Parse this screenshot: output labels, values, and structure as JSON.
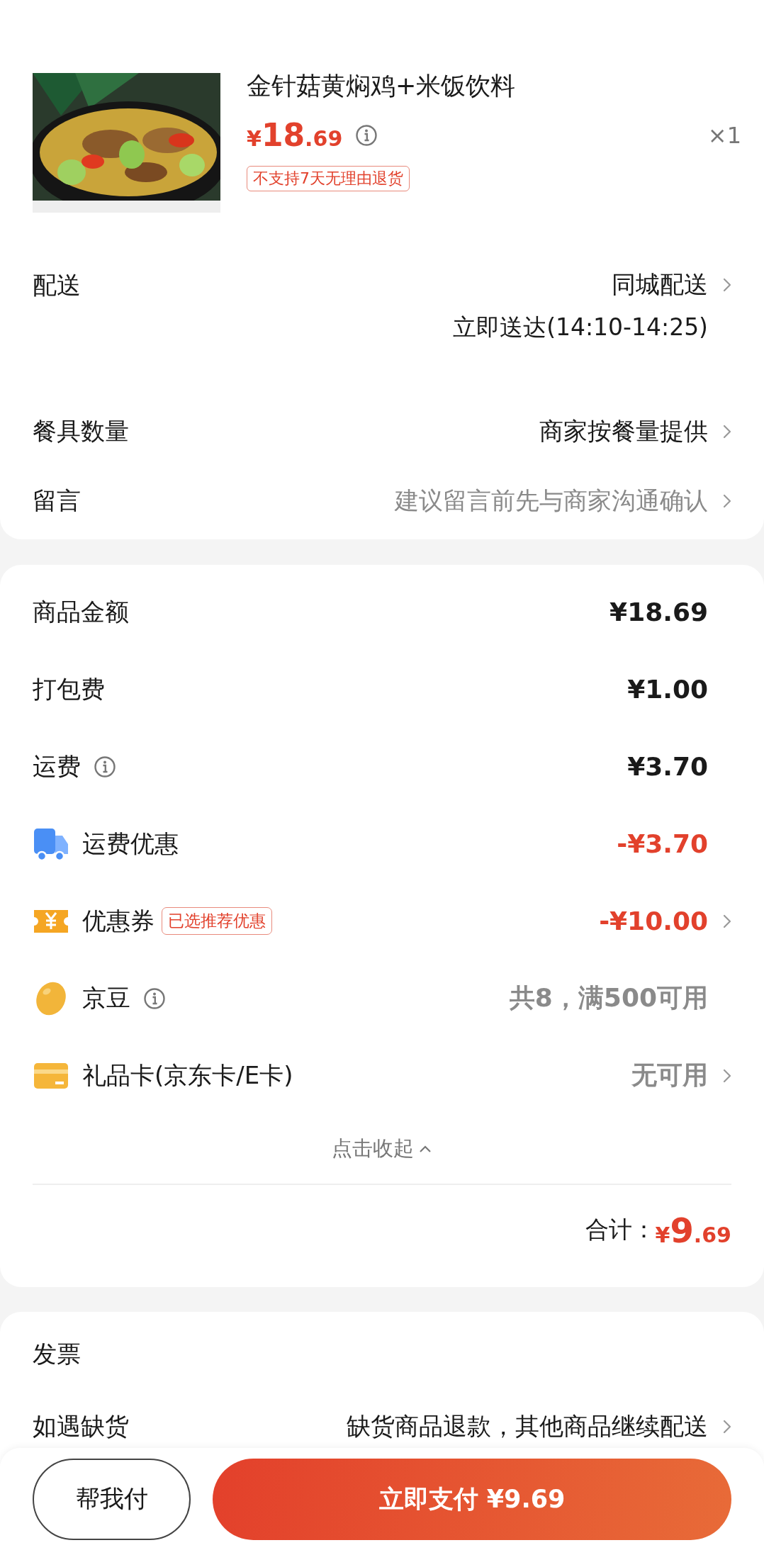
{
  "product": {
    "title": "金针菇黄焖鸡+米饭饮料",
    "price_symbol": "¥",
    "price_int": "18",
    "price_dec": ".69",
    "info": true,
    "quantity": "×1",
    "tag": "不支持7天无理由退货"
  },
  "order_rows": [
    {
      "label": "配送",
      "value": "同城配送",
      "sub": "立即送达(14:10-14:25)",
      "muted": false,
      "arrow": true
    },
    {
      "label": "餐具数量",
      "value": "商家按餐量提供",
      "muted": false,
      "arrow": true
    },
    {
      "label": "留言",
      "value": "建议留言前先与商家沟通确认",
      "muted": true,
      "arrow": true
    }
  ],
  "fee_rows": [
    {
      "kind": "plain",
      "label": "商品金额",
      "info": false,
      "value": "¥18.69",
      "color": "#1a1a1a",
      "arrow": false
    },
    {
      "kind": "plain",
      "label": "打包费",
      "info": false,
      "value": "¥1.00",
      "color": "#1a1a1a",
      "arrow": false
    },
    {
      "kind": "plain",
      "label": "运费",
      "info": true,
      "value": "¥3.70",
      "color": "#1a1a1a",
      "arrow": false
    },
    {
      "kind": "truck",
      "label": "运费优惠",
      "info": false,
      "value": "-¥3.70",
      "color": "#e2412c",
      "arrow": false
    },
    {
      "kind": "coupon",
      "label": "优惠券",
      "tag": "已选推荐优惠",
      "info": false,
      "value": "-¥10.00",
      "color": "#e2412c",
      "arrow": true
    },
    {
      "kind": "bean",
      "label": "京豆",
      "info": true,
      "value": "共8，满500可用",
      "color": "#8a8a8a",
      "arrow": false
    },
    {
      "kind": "card",
      "label": "礼品卡(京东卡/E卡)",
      "info": false,
      "value": "无可用",
      "color": "#8a8a8a",
      "arrow": true
    }
  ],
  "collapse": {
    "label": "点击收起",
    "expanded": true
  },
  "total": {
    "label": "合计：",
    "symbol": "¥",
    "int": "9",
    "dec": ".69"
  },
  "invoice": {
    "label": "发票"
  },
  "stockout": {
    "label": "如遇缺货",
    "value": "缺货商品退款，其他商品继续配送",
    "arrow": true
  },
  "buttons": {
    "help": "帮我付",
    "pay": "立即支付 ¥9.69"
  }
}
